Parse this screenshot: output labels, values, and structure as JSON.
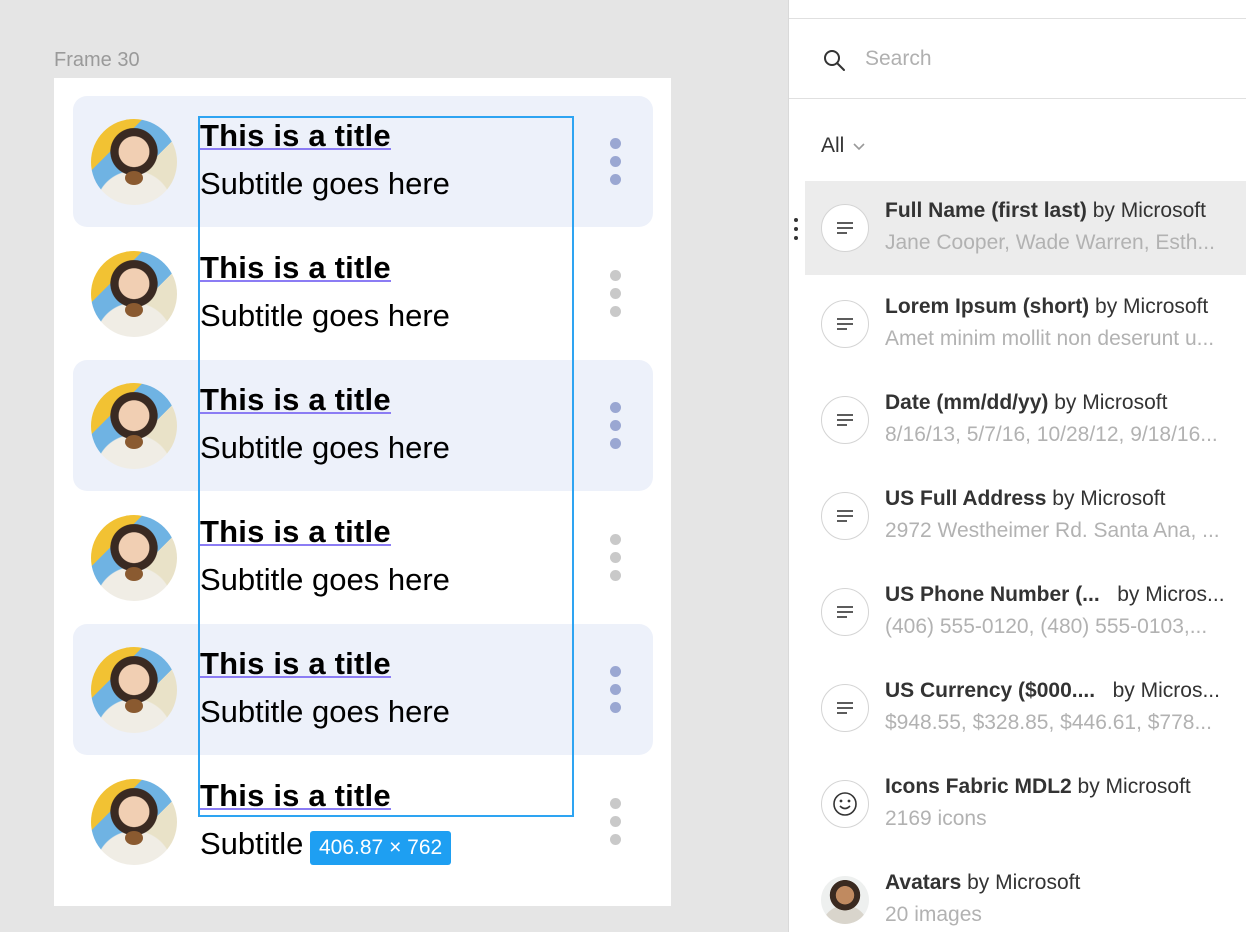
{
  "canvas": {
    "frame_label": "Frame 30",
    "rows": [
      {
        "title": "This is a title",
        "subtitle": "Subtitle goes here"
      },
      {
        "title": "This is a title",
        "subtitle": "Subtitle goes here"
      },
      {
        "title": "This is a title",
        "subtitle": "Subtitle goes here"
      },
      {
        "title": "This is a title",
        "subtitle": "Subtitle goes here"
      },
      {
        "title": "This is a title",
        "subtitle": "Subtitle goes here"
      },
      {
        "title": "This is a title",
        "subtitle": "Subtitle"
      }
    ],
    "selection_dimensions": "406.87 × 762"
  },
  "panel": {
    "search": {
      "placeholder": "Search",
      "value": ""
    },
    "filter_label": "All",
    "items": [
      {
        "name": "Full Name (first last)",
        "by": "by Microsoft",
        "desc": "Jane Cooper, Wade Warren, Esth...",
        "icon": "text-lines-icon"
      },
      {
        "name": "Lorem Ipsum (short)",
        "by": "by Microsoft",
        "desc": "Amet minim mollit non deserunt u...",
        "icon": "text-lines-icon"
      },
      {
        "name": "Date (mm/dd/yy)",
        "by": "by Microsoft",
        "desc": "8/16/13, 5/7/16, 10/28/12, 9/18/16...",
        "icon": "text-lines-icon"
      },
      {
        "name": "US Full Address",
        "by": "by Microsoft",
        "desc": "2972 Westheimer Rd. Santa Ana, ...",
        "icon": "text-lines-icon"
      },
      {
        "name": "US Phone Number (...",
        "by": "by Micros...",
        "desc": "(406) 555-0120, (480) 555-0103,...",
        "icon": "text-lines-icon"
      },
      {
        "name": "US Currency ($000....",
        "by": "by Micros...",
        "desc": "$948.55, $328.85, $446.61, $778...",
        "icon": "text-lines-icon"
      },
      {
        "name": "Icons Fabric MDL2",
        "by": "by Microsoft",
        "desc": "2169 icons",
        "icon": "smiley-icon"
      },
      {
        "name": "Avatars",
        "by": "by Microsoft",
        "desc": "20 images",
        "icon": "avatar-photo"
      }
    ]
  },
  "colors": {
    "selection": "#2ea4f2",
    "row_highlight": "#edf1fa",
    "title_underline": "#8b7cf4"
  }
}
